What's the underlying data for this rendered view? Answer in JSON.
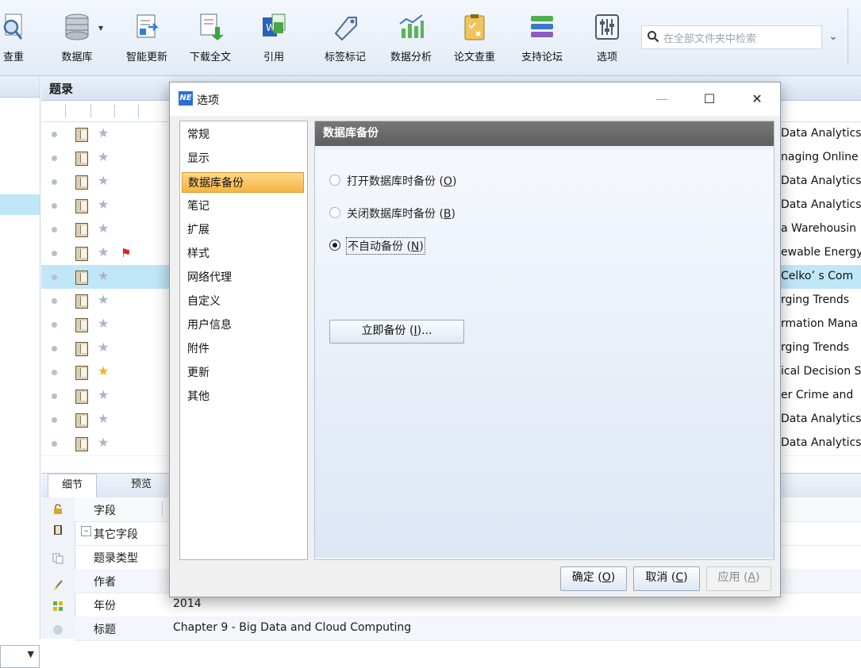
{
  "toolbar": {
    "items": [
      {
        "label": "查重",
        "icon": "duplicate-search-icon"
      },
      {
        "label": "数据库",
        "icon": "database-icon"
      },
      {
        "label": "智能更新",
        "icon": "smart-update-icon"
      },
      {
        "label": "下载全文",
        "icon": "download-fulltext-icon"
      },
      {
        "label": "引用",
        "icon": "citation-icon"
      },
      {
        "label": "标签标记",
        "icon": "tag-icon"
      },
      {
        "label": "数据分析",
        "icon": "data-analysis-icon"
      },
      {
        "label": "论文查重",
        "icon": "paper-check-icon"
      },
      {
        "label": "支持论坛",
        "icon": "forum-icon"
      },
      {
        "label": "选项",
        "icon": "options-icon"
      }
    ],
    "search_placeholder": "在全部文件夹中检索"
  },
  "list": {
    "header": "题录",
    "rows": [
      {
        "title": "Data Analytics",
        "starred": false,
        "flag": false,
        "selected": false
      },
      {
        "title": "naging Online",
        "starred": false,
        "flag": false,
        "selected": false
      },
      {
        "title": "Data Analytics",
        "starred": false,
        "flag": false,
        "selected": false
      },
      {
        "title": "Data Analytics",
        "starred": false,
        "flag": false,
        "selected": false
      },
      {
        "title": "a Warehousin",
        "starred": false,
        "flag": false,
        "selected": false
      },
      {
        "title": "ewable Energy",
        "starred": false,
        "flag": true,
        "selected": false
      },
      {
        "title": "Celko’ s Com",
        "starred": false,
        "flag": false,
        "selected": true
      },
      {
        "title": "rging Trends",
        "starred": false,
        "flag": false,
        "selected": false
      },
      {
        "title": "rmation Mana",
        "starred": false,
        "flag": false,
        "selected": false
      },
      {
        "title": "rging Trends",
        "starred": false,
        "flag": false,
        "selected": false
      },
      {
        "title": "ical Decision S",
        "starred": true,
        "flag": false,
        "selected": false
      },
      {
        "title": "er Crime and",
        "starred": false,
        "flag": false,
        "selected": false
      },
      {
        "title": "Data Analytics",
        "starred": false,
        "flag": false,
        "selected": false
      },
      {
        "title": "Data Analytics",
        "starred": false,
        "flag": false,
        "selected": false
      }
    ]
  },
  "details": {
    "tabs": [
      "细节",
      "预览"
    ],
    "field_header": "字段",
    "group_label": "其它字段",
    "fields": [
      {
        "key": "题录类型",
        "value": ""
      },
      {
        "key": "作者",
        "value": ""
      },
      {
        "key": "年份",
        "value": "2014"
      },
      {
        "key": "标题",
        "value": "Chapter 9 - Big Data and Cloud Computing"
      }
    ]
  },
  "dialog": {
    "title": "选项",
    "app_icon": "NE",
    "categories": [
      "常规",
      "显示",
      "数据库备份",
      "笔记",
      "扩展",
      "样式",
      "网络代理",
      "自定义",
      "用户信息",
      "附件",
      "更新",
      "其他"
    ],
    "selected_category": "数据库备份",
    "panel_title": "数据库备份",
    "options": [
      {
        "label": "打开数据库时备份",
        "key": "O",
        "selected": false
      },
      {
        "label": "关闭数据库时备份",
        "key": "B",
        "selected": false
      },
      {
        "label": "不自动备份",
        "key": "N",
        "selected": true
      }
    ],
    "backup_now_label": "立即备份",
    "backup_now_key": "I",
    "buttons": {
      "ok": {
        "label": "确定",
        "key": "O"
      },
      "cancel": {
        "label": "取消",
        "key": "C"
      },
      "apply": {
        "label": "应用",
        "key": "A"
      }
    }
  }
}
